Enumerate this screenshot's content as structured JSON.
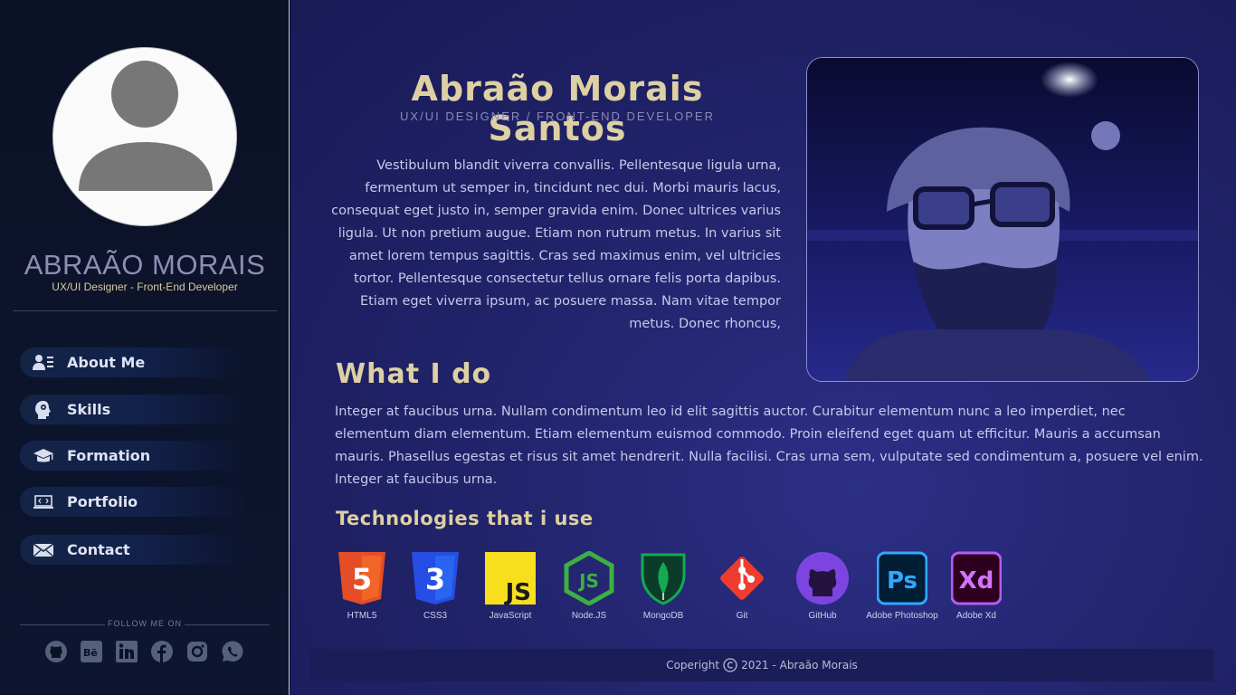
{
  "sidebar": {
    "name": "ABRAÃO MORAIS",
    "role": "UX/UI Designer - Front-End Developer",
    "nav": [
      {
        "label": "About Me",
        "icon": "user-list-icon"
      },
      {
        "label": "Skills",
        "icon": "head-gear-icon"
      },
      {
        "label": "Formation",
        "icon": "graduation-cap-icon"
      },
      {
        "label": "Portfolio",
        "icon": "code-monitor-icon"
      },
      {
        "label": "Contact",
        "icon": "envelope-icon"
      }
    ],
    "follow_label": "FOLLOW ME ON",
    "socials": [
      "github-icon",
      "behance-icon",
      "linkedin-icon",
      "facebook-icon",
      "instagram-icon",
      "whatsapp-icon"
    ]
  },
  "main": {
    "title": "Abraão Morais Santos",
    "subtitle": "UX/UI DESIGNER / FRONT-END DEVELOPER",
    "intro": "Vestibulum blandit viverra convallis. Pellentesque ligula urna, fermentum ut semper in, tincidunt nec dui. Morbi mauris lacus, consequat eget justo in, semper gravida enim. Donec ultrices varius ligula. Ut non pretium augue. Etiam non rutrum metus. In varius sit amet lorem tempus sagittis. Cras sed maximus enim, vel ultricies tortor. Pellentesque consectetur tellus ornare felis porta dapibus. Etiam eget viverra ipsum, ac posuere massa. Nam vitae tempor metus. Donec rhoncus,",
    "what_i_do_heading": "What I do",
    "what_i_do_text": "Integer at faucibus urna. Nullam condimentum leo id elit sagittis auctor. Curabitur elementum nunc a leo imperdiet, nec elementum diam elementum. Etiam elementum euismod commodo. Proin eleifend eget quam ut efficitur. Mauris a accumsan mauris. Phasellus egestas et risus sit amet hendrerit. Nulla facilisi. Cras urna sem, vulputate sed condimentum a, posuere vel enim. Integer at faucibus urna.",
    "tech_heading": "Technologies that i use",
    "technologies": [
      {
        "label": "HTML5",
        "icon": "html5-icon",
        "color": "#e44d26",
        "badge": "5"
      },
      {
        "label": "CSS3",
        "icon": "css3-icon",
        "color": "#2965f1",
        "badge": "3"
      },
      {
        "label": "JavaScript",
        "icon": "javascript-icon",
        "color": "#f7df1e",
        "badge": "JS"
      },
      {
        "label": "Node.JS",
        "icon": "nodejs-icon",
        "color": "#3cb043",
        "badge": "JS"
      },
      {
        "label": "MongoDB",
        "icon": "mongodb-icon",
        "color": "#13aa52"
      },
      {
        "label": "Git",
        "icon": "git-icon",
        "color": "#f03c2e"
      },
      {
        "label": "GitHub",
        "icon": "github-icon",
        "color": "#6e40c9"
      },
      {
        "label": "Adobe Photoshop",
        "icon": "photoshop-icon",
        "color": "#31a8ff",
        "badge": "Ps"
      },
      {
        "label": "Adobe Xd",
        "icon": "adobe-xd-icon",
        "color": "#b65bf2",
        "badge": "Xd"
      }
    ],
    "footer_prefix": "Coperight",
    "footer_text": "2021 - Abraão Morais"
  }
}
